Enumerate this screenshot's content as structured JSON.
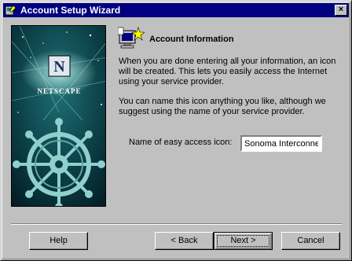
{
  "window": {
    "title": "Account Setup Wizard",
    "close_label": "×"
  },
  "banner": {
    "brand": "NETSCAPE",
    "logo_letter": "N"
  },
  "page": {
    "heading": "Account Information",
    "paragraph_1": "When you are done entering all your information, an icon will be created.  This lets you easily access the Internet using your service provider.",
    "paragraph_2": "You can name this icon anything you like, although we suggest using the name of your service provider.",
    "field_label": "Name of easy access icon:",
    "field_value": "Sonoma Interconnect"
  },
  "buttons": {
    "help": "Help",
    "back": "< Back",
    "next": "Next >",
    "cancel": "Cancel"
  },
  "colors": {
    "titlebar": "#000080",
    "face": "#c0c0c0",
    "banner_sky": "#0b3d45",
    "banner_wheel": "#8fd0cf"
  }
}
